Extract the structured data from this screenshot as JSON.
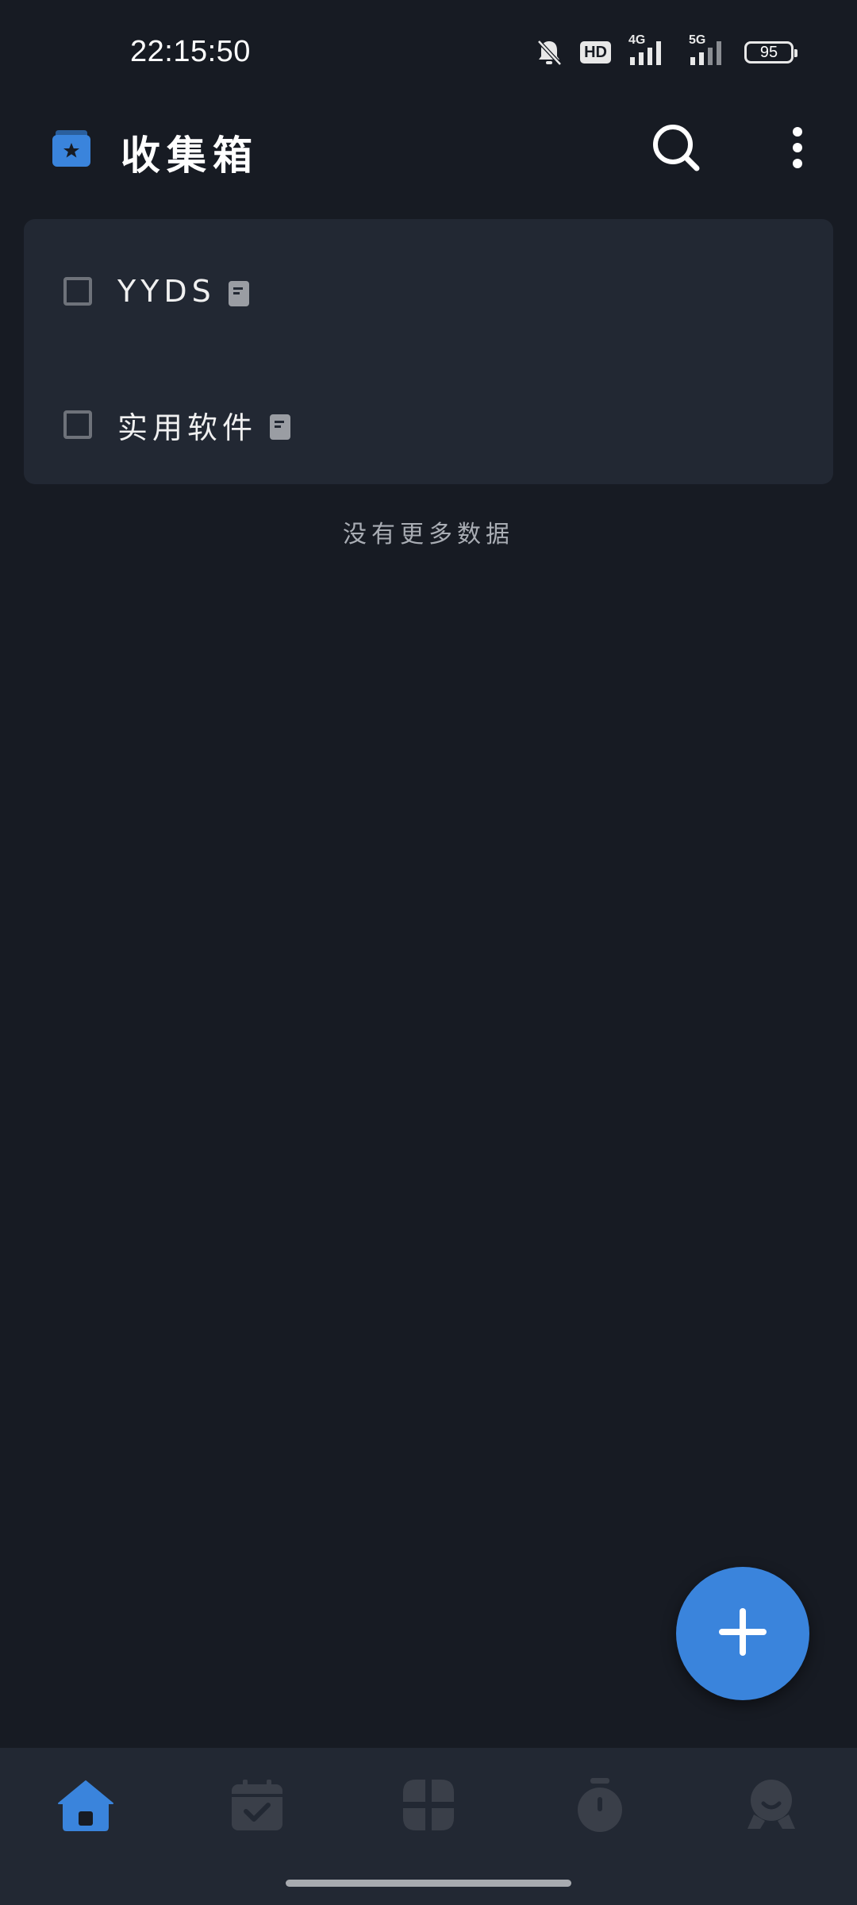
{
  "status_bar": {
    "time": "22:15:50",
    "battery": "95",
    "hd_label": "HD",
    "signal_4g_label": "4G",
    "signal_5g_label": "5G"
  },
  "header": {
    "title": "收集箱",
    "logo_icon": "inbox-star-icon",
    "search_icon": "search-icon",
    "more_icon": "more-vertical-icon"
  },
  "list": {
    "items": [
      {
        "label": "YYDS",
        "checked": false,
        "has_note": true
      },
      {
        "label": "实用软件",
        "checked": false,
        "has_note": true
      }
    ]
  },
  "footer_text": "没有更多数据",
  "fab": {
    "icon": "plus-icon"
  },
  "bottom_nav": {
    "items": [
      {
        "icon": "home-icon",
        "active": true
      },
      {
        "icon": "calendar-check-icon",
        "active": false
      },
      {
        "icon": "apps-grid-icon",
        "active": false
      },
      {
        "icon": "timer-icon",
        "active": false
      },
      {
        "icon": "profile-icon",
        "active": false
      }
    ]
  },
  "colors": {
    "background": "#171b23",
    "card": "#222833",
    "accent": "#3a84dc",
    "inactive_icon": "#3a3f49"
  }
}
